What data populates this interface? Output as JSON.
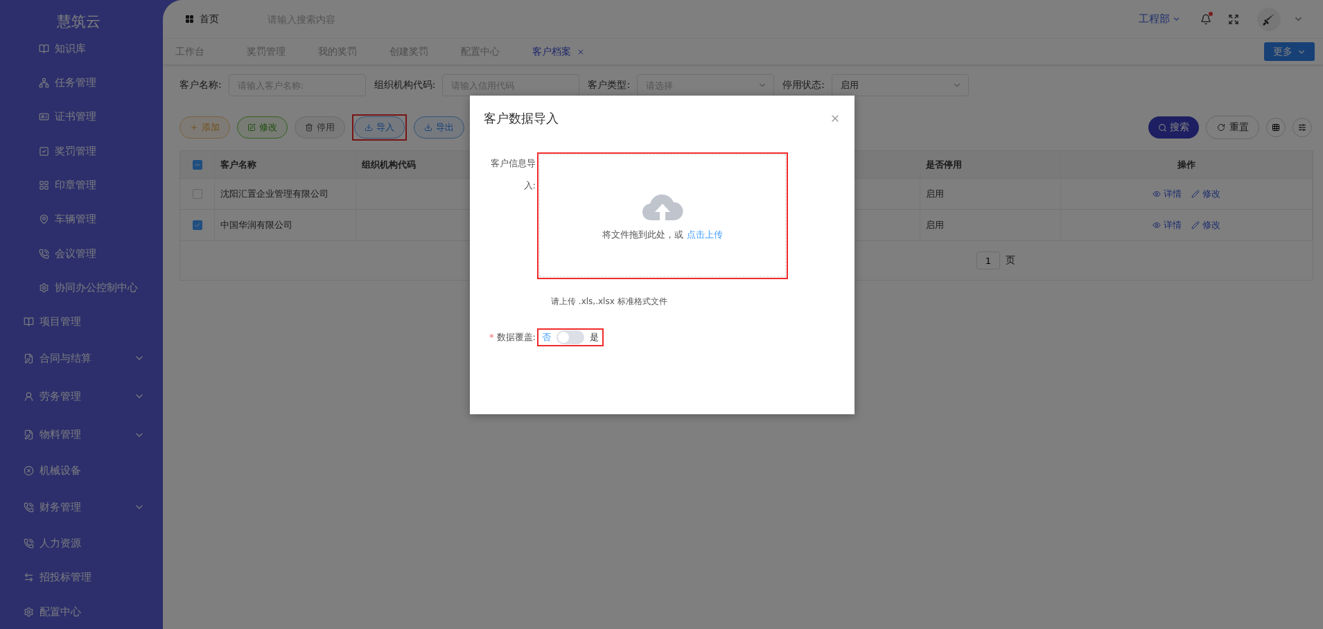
{
  "sidebar": {
    "logo": "慧筑云",
    "items": [
      {
        "label": "知识库",
        "kind": "sub",
        "has_submenu": false
      },
      {
        "label": "任务管理",
        "kind": "sub",
        "has_submenu": false
      },
      {
        "label": "证书管理",
        "kind": "sub",
        "has_submenu": false
      },
      {
        "label": "奖罚管理",
        "kind": "sub",
        "has_submenu": false
      },
      {
        "label": "印章管理",
        "kind": "sub",
        "has_submenu": false
      },
      {
        "label": "车辆管理",
        "kind": "sub",
        "has_submenu": false
      },
      {
        "label": "会议管理",
        "kind": "sub",
        "has_submenu": false
      },
      {
        "label": "协同办公控制中心",
        "kind": "sub",
        "has_submenu": false
      },
      {
        "label": "项目管理",
        "kind": "main",
        "has_submenu": false
      },
      {
        "label": "合同与结算",
        "kind": "main",
        "has_submenu": true
      },
      {
        "label": "劳务管理",
        "kind": "main",
        "has_submenu": true
      },
      {
        "label": "物料管理",
        "kind": "main",
        "has_submenu": true
      },
      {
        "label": "机械设备",
        "kind": "main",
        "has_submenu": false
      },
      {
        "label": "财务管理",
        "kind": "main",
        "has_submenu": true
      },
      {
        "label": "人力资源",
        "kind": "main",
        "has_submenu": false
      },
      {
        "label": "招投标管理",
        "kind": "main",
        "has_submenu": false
      },
      {
        "label": "配置中心",
        "kind": "main",
        "has_submenu": false
      }
    ]
  },
  "header": {
    "home": "首页",
    "search_placeholder": "请输入搜索内容",
    "department": "工程部",
    "has_notification": true
  },
  "tabs": [
    {
      "label": "工作台",
      "selected": false
    },
    {
      "label": "奖罚管理",
      "selected": false
    },
    {
      "label": "我的奖罚",
      "selected": false
    },
    {
      "label": "创建奖罚",
      "selected": false
    },
    {
      "label": "配置中心",
      "selected": false
    },
    {
      "label": "客户档案",
      "selected": true
    }
  ],
  "more_button": "更多",
  "filters": [
    {
      "label": "客户名称:",
      "kind": "input",
      "placeholder": "请输入客户名称:"
    },
    {
      "label": "组织机构代码:",
      "kind": "input",
      "placeholder": "请输入信用代码"
    },
    {
      "label": "客户类型:",
      "kind": "select",
      "placeholder": "请选择"
    },
    {
      "label": "停用状态:",
      "kind": "select",
      "value": "启用"
    }
  ],
  "actions": [
    {
      "label": "添加",
      "kind": "add",
      "highlighted": false
    },
    {
      "label": "修改",
      "kind": "edit",
      "highlighted": false
    },
    {
      "label": "停用",
      "kind": "disable",
      "highlighted": false
    },
    {
      "label": "导入",
      "kind": "import",
      "highlighted": true
    },
    {
      "label": "导出",
      "kind": "export",
      "highlighted": false
    }
  ],
  "search_button": "搜索",
  "reset_button": "重置",
  "table": {
    "header_checkbox_indeterminate": true,
    "columns": [
      "客户名称",
      "组织机构代码",
      "是否停用",
      "操作"
    ],
    "rows": [
      {
        "checked": false,
        "name": "沈阳汇置企业管理有限公司",
        "status": "启用",
        "actions": [
          "详情",
          "修改"
        ]
      },
      {
        "checked": true,
        "name": "中国华润有限公司",
        "status": "启用",
        "actions": [
          "详情",
          "修改"
        ]
      }
    ],
    "pagination": {
      "page": "1",
      "suffix": "页"
    }
  },
  "modal": {
    "title": "客户数据导入",
    "upload_label": "客户信息导入:",
    "upload_text": "将文件拖到此处，或",
    "upload_link": "点击上传",
    "upload_highlighted": true,
    "hint": "请上传 .xls,.xlsx 标准格式文件",
    "switch_label": "数据覆盖:",
    "required_mark": "*",
    "switch_off_text": "否",
    "switch_on_text": "是",
    "switch_on": false,
    "switch_highlighted": true
  }
}
